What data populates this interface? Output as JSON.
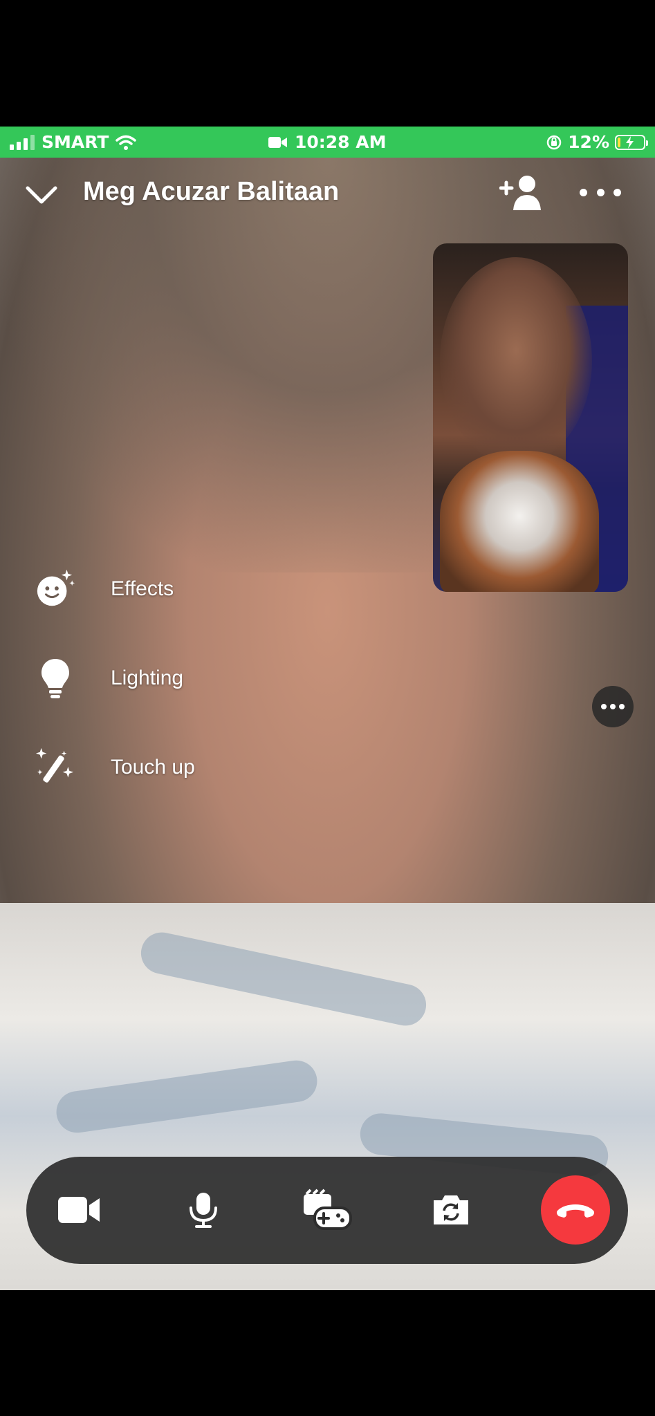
{
  "status_bar": {
    "carrier": "SMART",
    "time": "10:28 AM",
    "battery_percent": "12%",
    "battery_level": 0.12,
    "bar_color": "#34c759"
  },
  "call": {
    "contact_name": "Meg Acuzar Balitaan",
    "icons": {
      "collapse": "chevron-down-icon",
      "add_person": "add-person-icon",
      "more": "more-horizontal-icon"
    }
  },
  "effects_menu": {
    "items": [
      {
        "label": "Effects",
        "icon": "smiley-sparkle-icon"
      },
      {
        "label": "Lighting",
        "icon": "lightbulb-icon"
      },
      {
        "label": "Touch up",
        "icon": "magic-wand-icon"
      }
    ]
  },
  "controls": {
    "items": [
      {
        "name": "camera",
        "icon": "video-camera-icon"
      },
      {
        "name": "microphone",
        "icon": "microphone-icon"
      },
      {
        "name": "activities",
        "icon": "games-icon"
      },
      {
        "name": "flip-camera",
        "icon": "flip-camera-icon"
      },
      {
        "name": "end-call",
        "icon": "end-call-icon"
      }
    ],
    "end_call_color": "#f5393e"
  }
}
